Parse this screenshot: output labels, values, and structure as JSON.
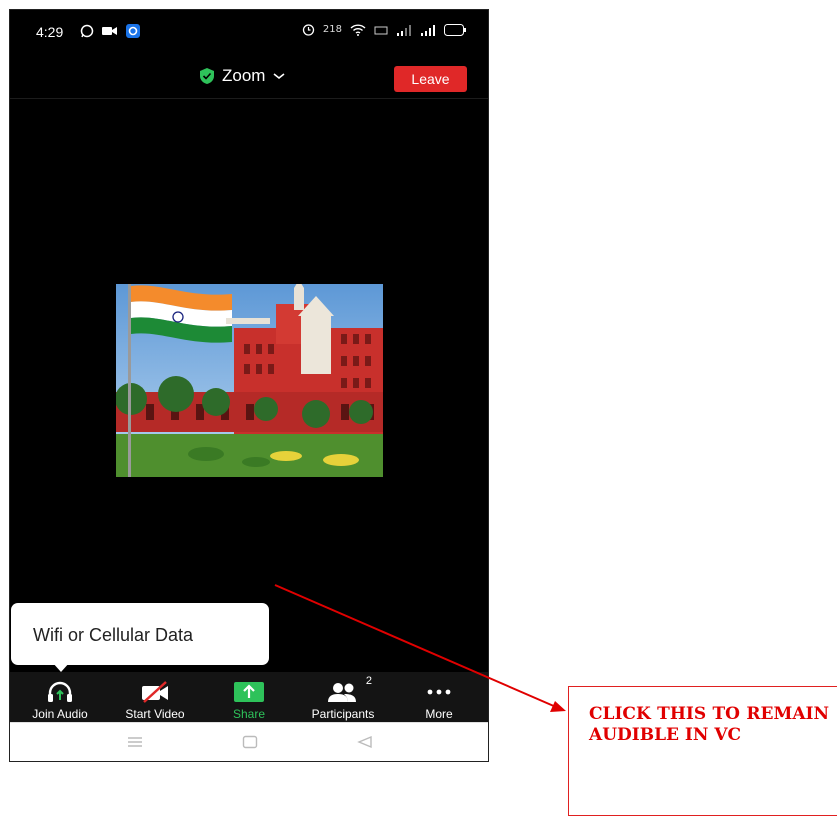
{
  "status_bar": {
    "time": "4:29",
    "left_icons": [
      "whatsapp-icon",
      "video-camera-icon",
      "app-notification-icon"
    ],
    "right_icons": [
      "alarm-icon",
      "network-speed-icon",
      "wifi-icon",
      "volte-icon",
      "signal-icon",
      "signal-icon",
      "battery-icon"
    ],
    "network_speed": "218",
    "battery": "50"
  },
  "header": {
    "title": "Zoom",
    "leave_label": "Leave",
    "shield_icon": "shield-check-icon",
    "dropdown_icon": "chevron-down-icon",
    "leave_color": "#e02828",
    "shield_color": "#2ec25a"
  },
  "video": {
    "image_alt": "Participant video / High Court photo with Indian flag"
  },
  "tooltip": {
    "text": "Wifi or Cellular Data"
  },
  "toolbar": {
    "items": [
      {
        "label": "Join Audio",
        "icon": "headphones-icon"
      },
      {
        "label": "Start Video",
        "icon": "video-off-icon"
      },
      {
        "label": "Share",
        "icon": "share-upload-icon"
      },
      {
        "label": "Participants",
        "icon": "participants-icon",
        "count": "2"
      },
      {
        "label": "More",
        "icon": "more-dots-icon"
      }
    ],
    "share_color": "#2ec25a"
  },
  "nav_bar": {
    "icons": [
      "menu-icon",
      "home-icon",
      "back-icon"
    ]
  },
  "callout": {
    "text": "CLICK THIS TO REMAIN AUDIBLE IN VC",
    "color": "#e00000"
  }
}
